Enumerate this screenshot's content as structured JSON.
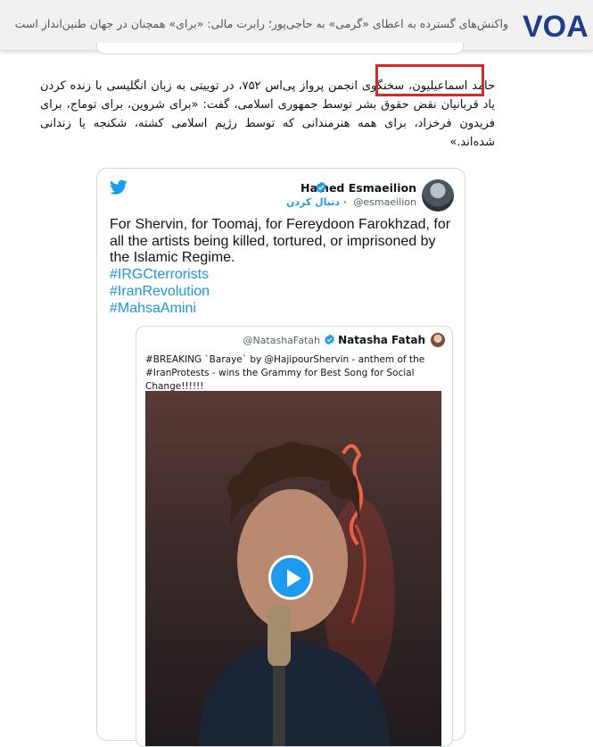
{
  "header": {
    "title": "واکنش‌های گسترده به اعطای «گرمی» به حاجی‌پور؛ رابرت مالی: «برای» همچنان در جهان طنین‌انداز است",
    "logo_text": "VOA"
  },
  "article": {
    "name_highlight": "حامد اسماعیلیون",
    "text": "، سخنگوی انجمن پرواز پی‌اس ۷۵۲، در توییتی به زبان انگلیسی با زنده کردن یاد قربانیان نقض حقوق بشر توسط جمهوری اسلامی، گفت: «برای شروین، برای توماج، برای فریدون فرخزاد، برای همه هنرمندانی که توسط رژیم اسلامی کشته، شکنجه یا زندانی شده‌اند.»"
  },
  "tweet": {
    "author_name": "Hamed Esmaeilion",
    "author_handle": "@esmaeilion",
    "follow_label": "· دنبال کردن",
    "text": "For Shervin, for Toomaj, for Fereydoon Farokhzad, for all the artists being killed, tortured, or imprisoned by the Islamic Regime.",
    "hashtags": [
      "#IRGCterrorists",
      "#IranRevolution",
      "#MahsaAmini"
    ],
    "quoted": {
      "author_name": "Natasha Fatah",
      "author_handle": "@NatashaFatah",
      "text": "#BREAKING `Baraye` by @HajipourShervin - anthem of the #IranProtests - wins the Grammy for Best Song for Social Change!!!!!!"
    }
  },
  "colors": {
    "highlight_border": "#d62a2a",
    "twitter_blue": "#1d9bf0",
    "voa_blue": "#1f3d8a"
  }
}
